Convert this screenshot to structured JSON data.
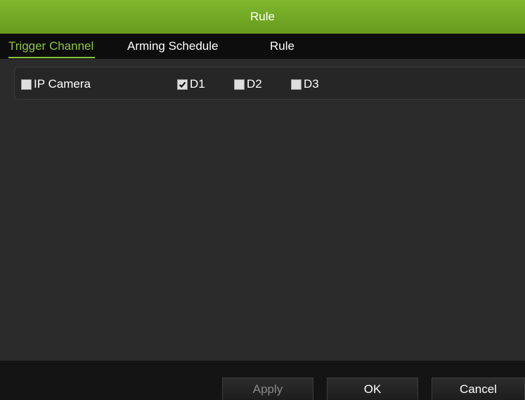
{
  "window": {
    "title": "Rule"
  },
  "tabs": [
    {
      "label": "Trigger Channel",
      "active": true
    },
    {
      "label": "Arming Schedule",
      "active": false
    },
    {
      "label": "Rule",
      "active": false
    }
  ],
  "channels": {
    "ip_camera": {
      "label": "IP Camera",
      "checked": false
    },
    "items": [
      {
        "label": "D1",
        "checked": true
      },
      {
        "label": "D2",
        "checked": false
      },
      {
        "label": "D3",
        "checked": false
      }
    ]
  },
  "footer": {
    "apply_label": "Apply",
    "ok_label": "OK",
    "cancel_label": "Cancel"
  },
  "colors": {
    "accent": "#8ec63f",
    "titlebar": "#72a824",
    "background": "#2b2b2b"
  }
}
